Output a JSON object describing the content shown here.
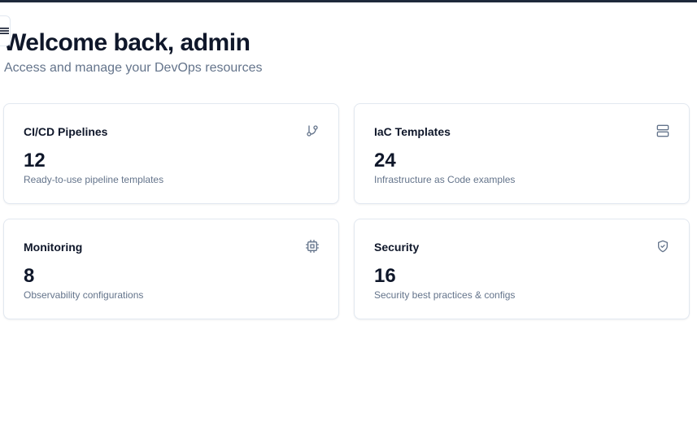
{
  "header": {
    "title": "Welcome back, admin",
    "subtitle": "Access and manage your DevOps resources"
  },
  "menu": {
    "icon": "menu-icon"
  },
  "cards": [
    {
      "title": "CI/CD Pipelines",
      "value": "12",
      "description": "Ready-to-use pipeline templates",
      "icon": "git-branch-icon"
    },
    {
      "title": "IaC Templates",
      "value": "24",
      "description": "Infrastructure as Code examples",
      "icon": "server-icon"
    },
    {
      "title": "Monitoring",
      "value": "8",
      "description": "Observability configurations",
      "icon": "cpu-icon"
    },
    {
      "title": "Security",
      "value": "16",
      "description": "Security best practices & configs",
      "icon": "shield-check-icon"
    }
  ],
  "colors": {
    "topbar": "#1e293b",
    "text": "#0f172a",
    "muted": "#64748b",
    "border": "#e2e8f0"
  }
}
